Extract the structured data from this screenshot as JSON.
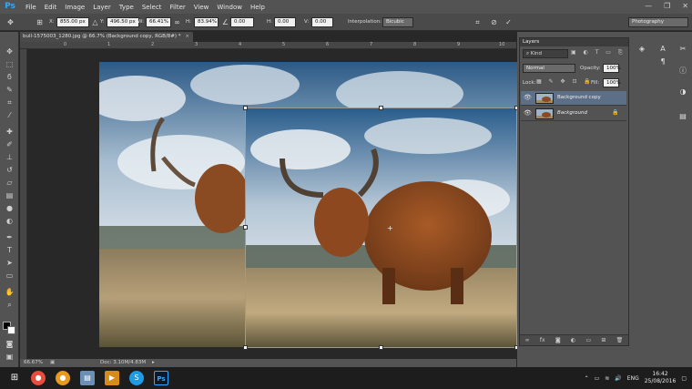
{
  "app": {
    "logo": "Ps"
  },
  "menu": [
    "File",
    "Edit",
    "Image",
    "Layer",
    "Type",
    "Select",
    "Filter",
    "View",
    "Window",
    "Help"
  ],
  "window_controls": {
    "minimize": "—",
    "maximize": "❐",
    "close": "✕"
  },
  "options": {
    "x_label": "X:",
    "x_value": "855.00 px",
    "y_label": "Y:",
    "y_value": "496.50 px",
    "w_label": "W:",
    "w_value": "66.41%",
    "h_label": "H:",
    "h_value": "83.94%",
    "angle_value": "0.00",
    "hskew_label": "H:",
    "hskew_value": "0.00",
    "vskew_label": "V:",
    "vskew_value": "0.00",
    "interpolation_label": "Interpolation:",
    "interpolation_value": "Bicubic",
    "workspace": "Photography"
  },
  "document": {
    "tab_title": "bull-1575003_1280.jpg @ 66.7% (Background copy, RGB/8#) *",
    "close": "×",
    "zoom": "66.67%",
    "doc_size": "Doc: 3.10M/4.83M"
  },
  "ruler_ticks": [
    "0",
    "1",
    "2",
    "3",
    "4",
    "5",
    "6",
    "7",
    "8",
    "9",
    "10"
  ],
  "layers": {
    "tab": "Layers",
    "filter_kind": "Kind",
    "blend_mode": "Normal",
    "opacity_label": "Opacity:",
    "opacity_value": "100%",
    "lock_label": "Lock:",
    "fill_label": "Fill:",
    "fill_value": "100%",
    "items": [
      {
        "name": "Background copy",
        "selected": true
      },
      {
        "name": "Background",
        "locked": true
      }
    ]
  },
  "taskbar": {
    "language": "ENG",
    "time": "16:42",
    "date": "25/08/2016"
  },
  "colors": {
    "accent": "#31a8ff",
    "panel": "#535353",
    "canvas": "#282828",
    "selected_layer": "#5d6f86"
  }
}
